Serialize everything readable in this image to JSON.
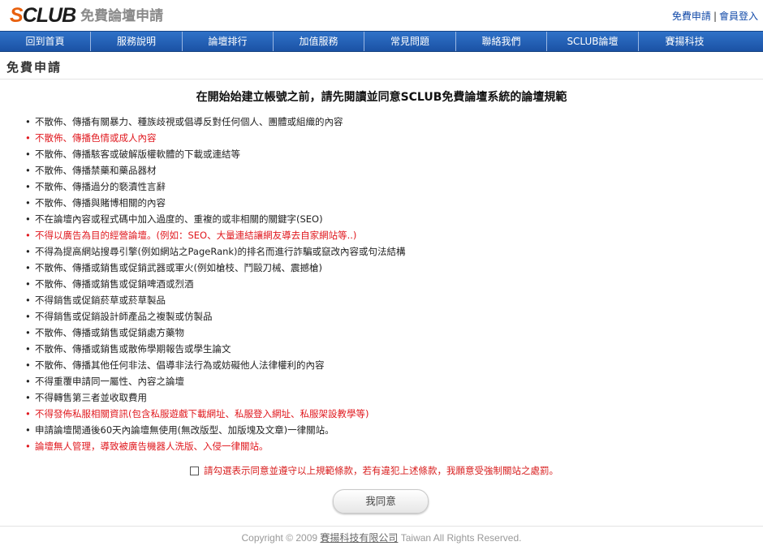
{
  "header": {
    "logo_main": "CLUB",
    "logo_initial": "S",
    "logo_sub": "免費論壇申請",
    "links": {
      "apply": "免費申請",
      "separator": "|",
      "login": "會員登入"
    }
  },
  "nav": {
    "items": [
      {
        "label": "回到首頁",
        "w": 112
      },
      {
        "label": "服務說明",
        "w": 113
      },
      {
        "label": "論壇排行",
        "w": 112
      },
      {
        "label": "加值服務",
        "w": 112
      },
      {
        "label": "常見問題",
        "w": 113
      },
      {
        "label": "聯絡我們",
        "w": 112
      },
      {
        "label": "SCLUB論壇",
        "w": 113
      },
      {
        "label": "賽揚科技",
        "w": 113
      }
    ]
  },
  "page": {
    "title": "免費申請"
  },
  "main": {
    "heading": "在開始始建立帳號之前，請先閱讀並同意SCLUB免費論壇系統的論壇規範",
    "rules": [
      {
        "text": "不散佈、傳播有關暴力、種族歧視或倡導反對任何個人、團體或組織的內容",
        "red": false
      },
      {
        "text": "不散佈、傳播色情或成人內容",
        "red": true
      },
      {
        "text": "不散佈、傳播駭客或破解版權軟體的下載或連結等",
        "red": false
      },
      {
        "text": "不散佈、傳播禁藥和藥品器材",
        "red": false
      },
      {
        "text": "不散佈、傳播過分的褻瀆性言辭",
        "red": false
      },
      {
        "text": "不散佈、傳播與賭博相關的內容",
        "red": false
      },
      {
        "text": "不在論壇內容或程式碼中加入過度的、重複的或非相關的關鍵字(SEO)",
        "red": false
      },
      {
        "text": "不得以廣告為目的經營論壇。(例如：SEO、大量連結讓網友導去自家網站等..)",
        "red": true
      },
      {
        "text": "不得為提高網站搜尋引擎(例如網站之PageRank)的排名而進行詐騙或竄改內容或句法結構",
        "red": false
      },
      {
        "text": "不散佈、傳播或銷售或促銷武器或軍火(例如槍枝、鬥毆刀械、震撼槍)",
        "red": false
      },
      {
        "text": "不散佈、傳播或銷售或促銷啤酒或烈酒",
        "red": false
      },
      {
        "text": "不得銷售或促銷菸草或菸草製品",
        "red": false
      },
      {
        "text": "不得銷售或促銷設計師產品之複製或仿製品",
        "red": false
      },
      {
        "text": "不散佈、傳播或銷售或促銷處方藥物",
        "red": false
      },
      {
        "text": "不散佈、傳播或銷售或散佈學期報告或學生論文",
        "red": false
      },
      {
        "text": "不散佈、傳播其他任何非法、倡導非法行為或妨礙他人法律權利的內容",
        "red": false
      },
      {
        "text": "不得重覆申請同一屬性、內容之論壇",
        "red": false
      },
      {
        "text": "不得轉售第三者並收取費用",
        "red": false
      },
      {
        "text": "不得發佈私服相關資訊(包含私服遊戲下載網址、私服登入網址、私服架設教學等)",
        "red": true
      },
      {
        "text": "申請論壇閒通後60天內論壇無使用(無改版型、加版塊及文章)一律關站。",
        "red": false
      },
      {
        "text": "論壇無人管理，導致被廣告機器人洗版、入侵一律關站。",
        "red": true
      }
    ],
    "agree_text": "請勾選表示同意並遵守以上規範條款，若有違犯上述條款，我願意受強制關站之處罰。",
    "agree_button": "我同意"
  },
  "footer": {
    "prefix": "Copyright © 2009 ",
    "company": "賽揚科技有限公司",
    "suffix": " Taiwan All Rights Reserved."
  }
}
